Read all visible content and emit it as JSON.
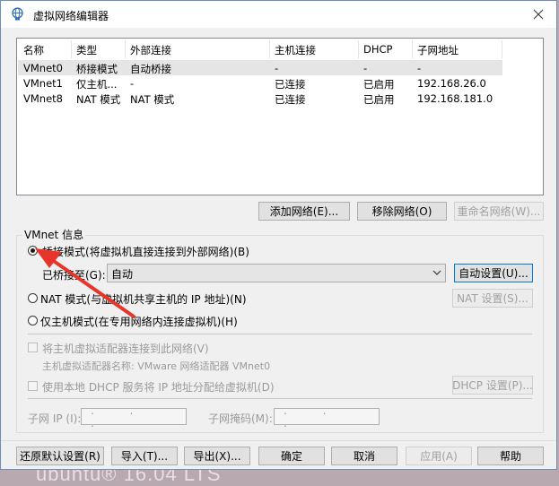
{
  "window": {
    "title": "虚拟网络编辑器"
  },
  "table": {
    "headers": [
      "名称",
      "类型",
      "外部连接",
      "主机连接",
      "DHCP",
      "子网地址"
    ],
    "rows": [
      [
        "VMnet0",
        "桥接模式",
        "自动桥接",
        "-",
        "-",
        "-"
      ],
      [
        "VMnet1",
        "仅主机...",
        "-",
        "已连接",
        "已启用",
        "192.168.26.0"
      ],
      [
        "VMnet8",
        "NAT 模式",
        "NAT 模式",
        "已连接",
        "已启用",
        "192.168.181.0"
      ]
    ]
  },
  "network_buttons": {
    "add": "添加网络(E)...",
    "remove": "移除网络(O)",
    "rename": "重命名网络(W)..."
  },
  "vmnet_info": {
    "title": "VMnet 信息",
    "bridge_radio": "桥接模式(将虚拟机直接连接到外部网络)(B)",
    "bridge_to_label": "已桥接至(G):",
    "bridge_to_value": "自动",
    "auto_settings": "自动设置(U)...",
    "nat_radio": "NAT 模式(与虚拟机共享主机的 IP 地址)(N)",
    "nat_settings": "NAT 设置(S)...",
    "hostonly_radio": "仅主机模式(在专用网络内连接虚拟机)(H)",
    "connect_adapter": "将主机虚拟适配器连接到此网络(V)",
    "adapter_name": "主机虚拟适配器名称: VMware 网络适配器 VMnet0",
    "use_dhcp": "使用本地 DHCP 服务将 IP 地址分配给虚拟机(D)",
    "dhcp_settings": "DHCP 设置(P)...",
    "subnet_ip_label": "子网 IP (I):",
    "subnet_mask_label": "子网掩码(M):",
    "ip_dots": ". . ."
  },
  "footer": {
    "restore": "还原默认设置(R)",
    "import": "导入(T)...",
    "export": "导出(X)...",
    "ok": "确定",
    "cancel": "取消",
    "apply": "应用(A)",
    "help": "帮助"
  },
  "background_text": "ubuntu® 16.04 LTS",
  "colors": {
    "selection": "#e5e5e5",
    "annotation_arrow": "#e8352b",
    "border_blue": "#6b8fb8"
  }
}
